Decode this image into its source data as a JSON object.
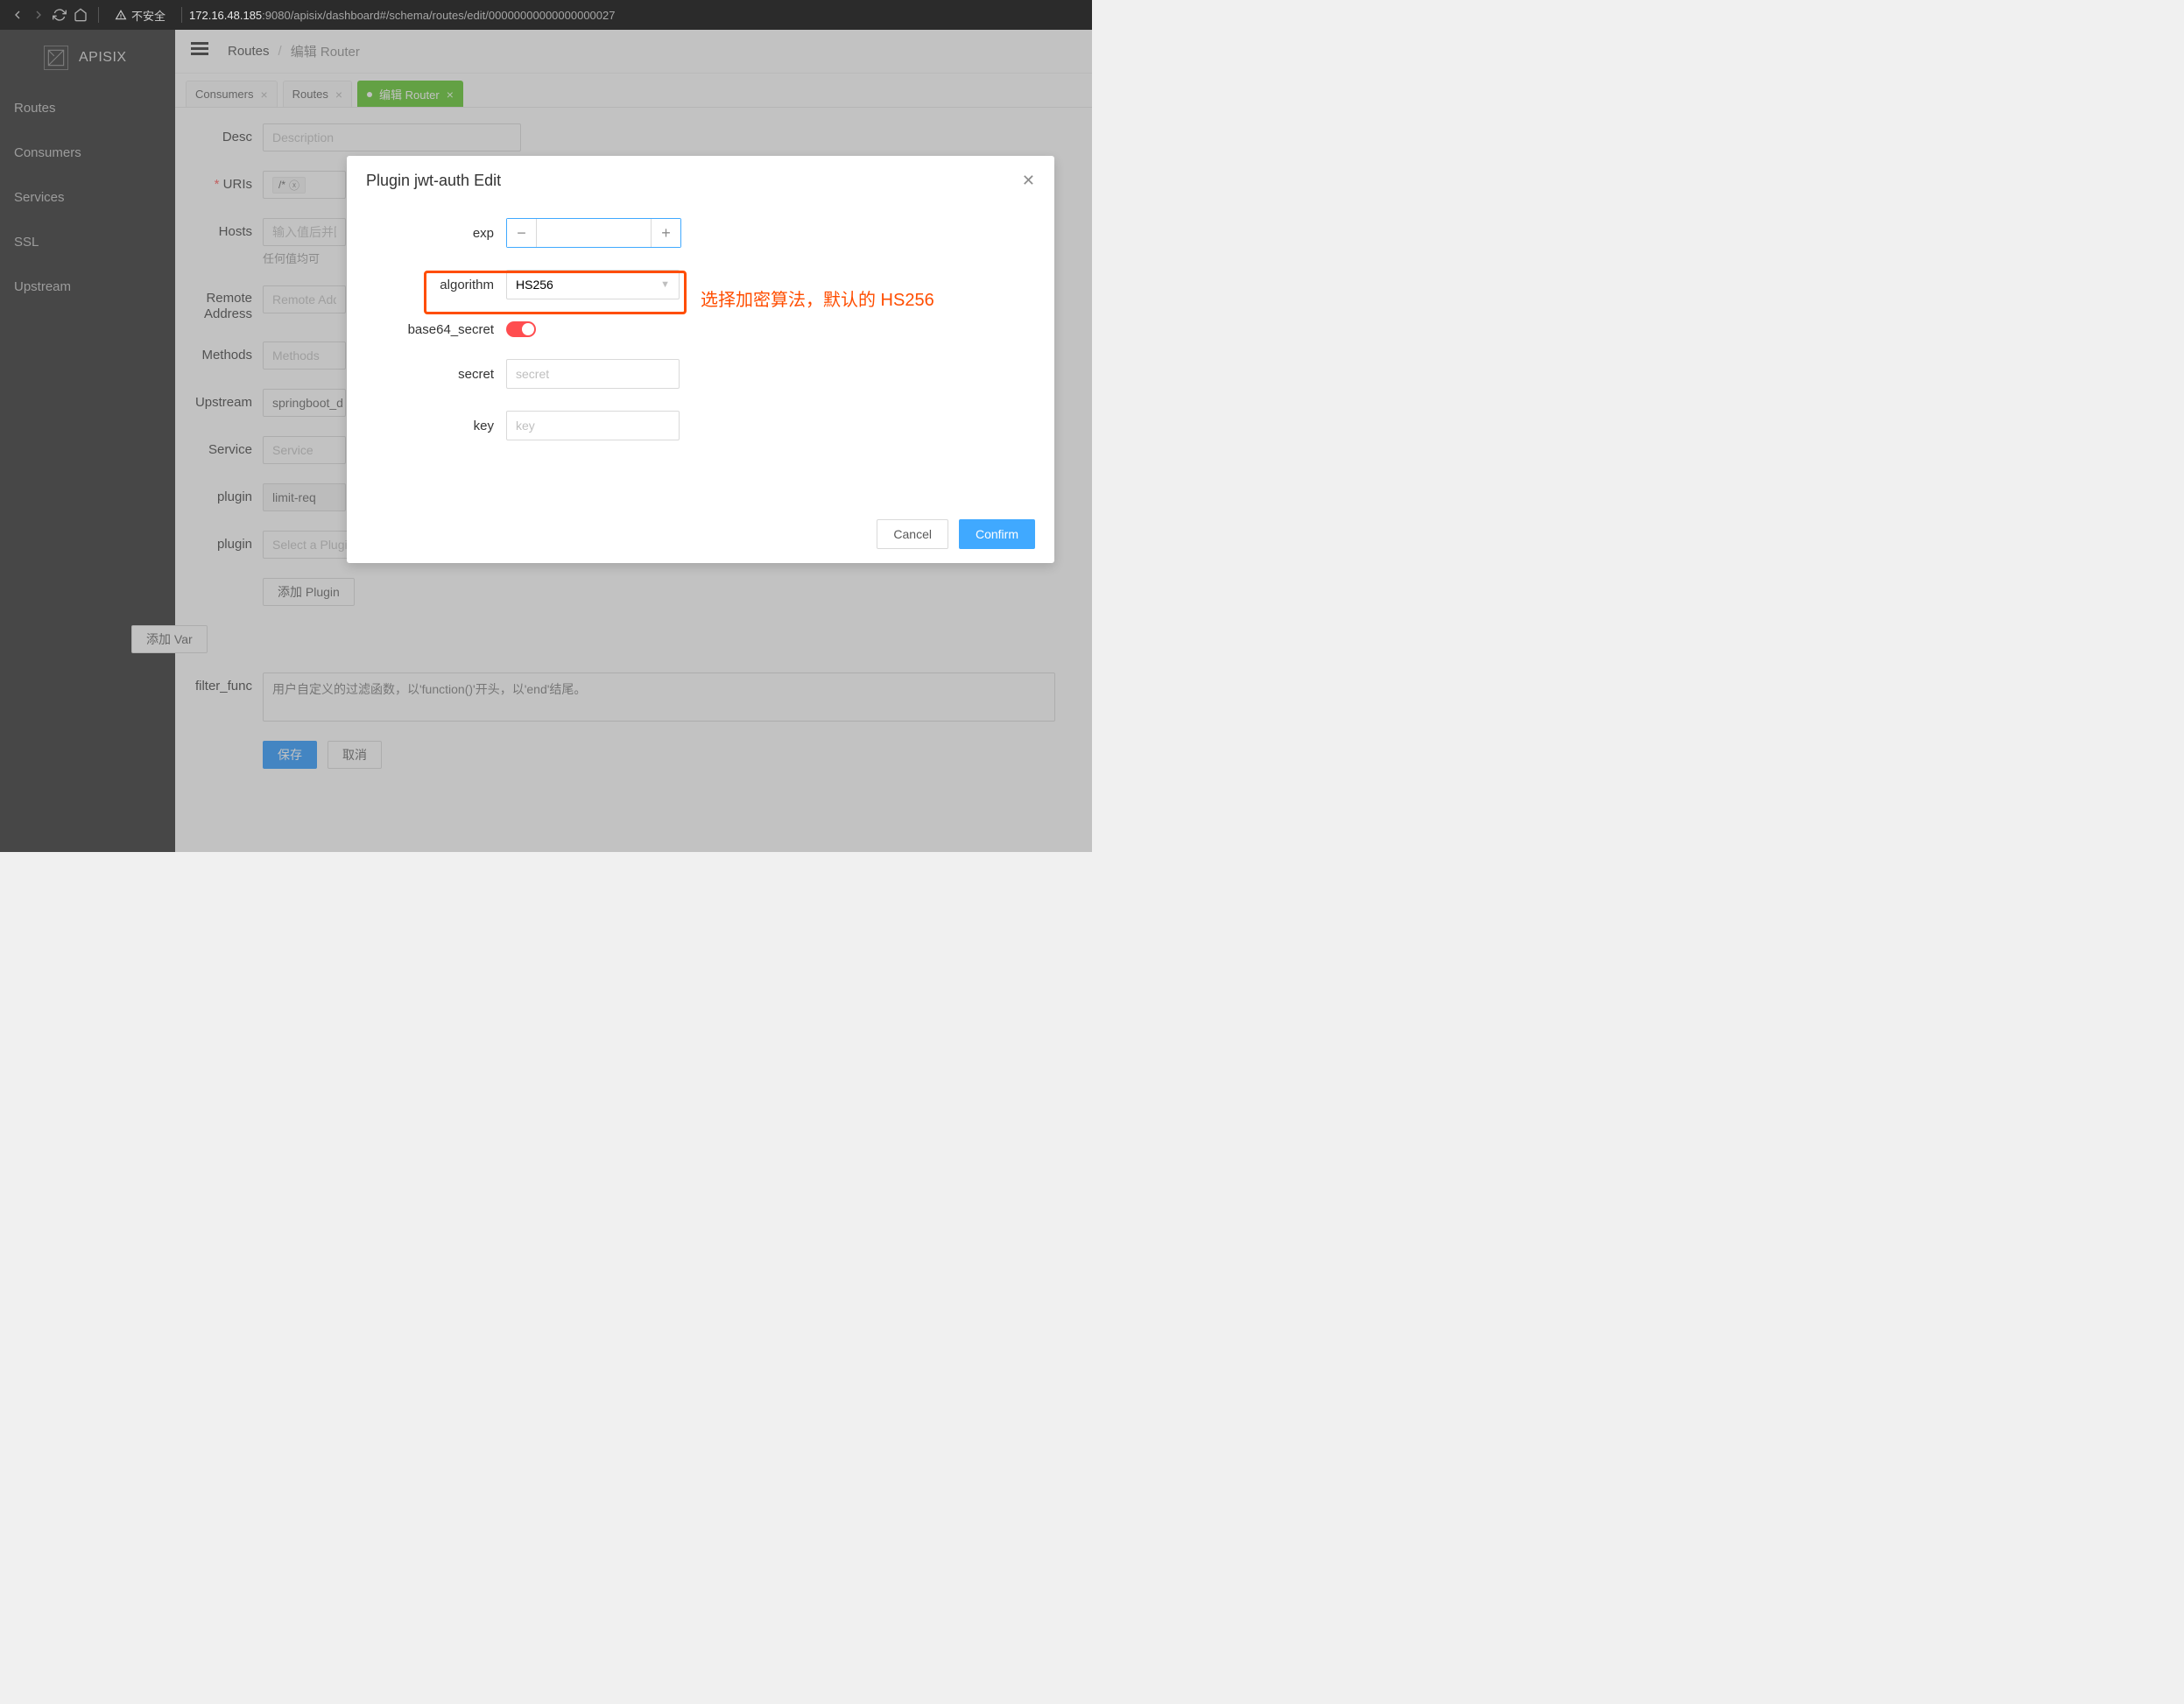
{
  "browser": {
    "warn_label": "不安全",
    "host": "172.16.48.185",
    "path": ":9080/apisix/dashboard#/schema/routes/edit/00000000000000000027"
  },
  "brand": {
    "name": "APISIX"
  },
  "sidebar": {
    "items": [
      "Routes",
      "Consumers",
      "Services",
      "SSL",
      "Upstream"
    ]
  },
  "breadcrumb": {
    "root": "Routes",
    "current": "编辑 Router"
  },
  "tabs": [
    {
      "label": "Consumers",
      "active": false
    },
    {
      "label": "Routes",
      "active": false
    },
    {
      "label": "编辑 Router",
      "active": true
    }
  ],
  "form": {
    "desc": {
      "label": "Desc",
      "placeholder": "Description"
    },
    "uris": {
      "label": "URIs",
      "tag": "/*"
    },
    "hosts": {
      "label": "Hosts",
      "placeholder": "输入值后并回",
      "helper": "任何值均可"
    },
    "remote_address": {
      "label": "Remote Address",
      "placeholder": "Remote Addr"
    },
    "methods": {
      "label": "Methods",
      "placeholder": "Methods"
    },
    "upstream": {
      "label": "Upstream",
      "value": "springboot_d"
    },
    "service": {
      "label": "Service",
      "placeholder": "Service"
    },
    "plugin1": {
      "label": "plugin",
      "value": "limit-req"
    },
    "plugin2": {
      "label": "plugin",
      "placeholder": "Select a Plugin"
    },
    "add_plugin": "添加 Plugin",
    "add_var": "添加 Var",
    "filter_func": {
      "label": "filter_func",
      "placeholder": "用户自定义的过滤函数，以'function()'开头，以'end'结尾。"
    },
    "save": "保存",
    "cancel": "取消"
  },
  "modal": {
    "title": "Plugin jwt-auth Edit",
    "fields": {
      "exp": {
        "label": "exp"
      },
      "algorithm": {
        "label": "algorithm",
        "value": "HS256"
      },
      "base64_secret": {
        "label": "base64_secret",
        "on": true
      },
      "secret": {
        "label": "secret",
        "placeholder": "secret"
      },
      "key": {
        "label": "key",
        "placeholder": "key"
      }
    },
    "cancel": "Cancel",
    "confirm": "Confirm"
  },
  "annotation": "选择加密算法，默认的 HS256"
}
